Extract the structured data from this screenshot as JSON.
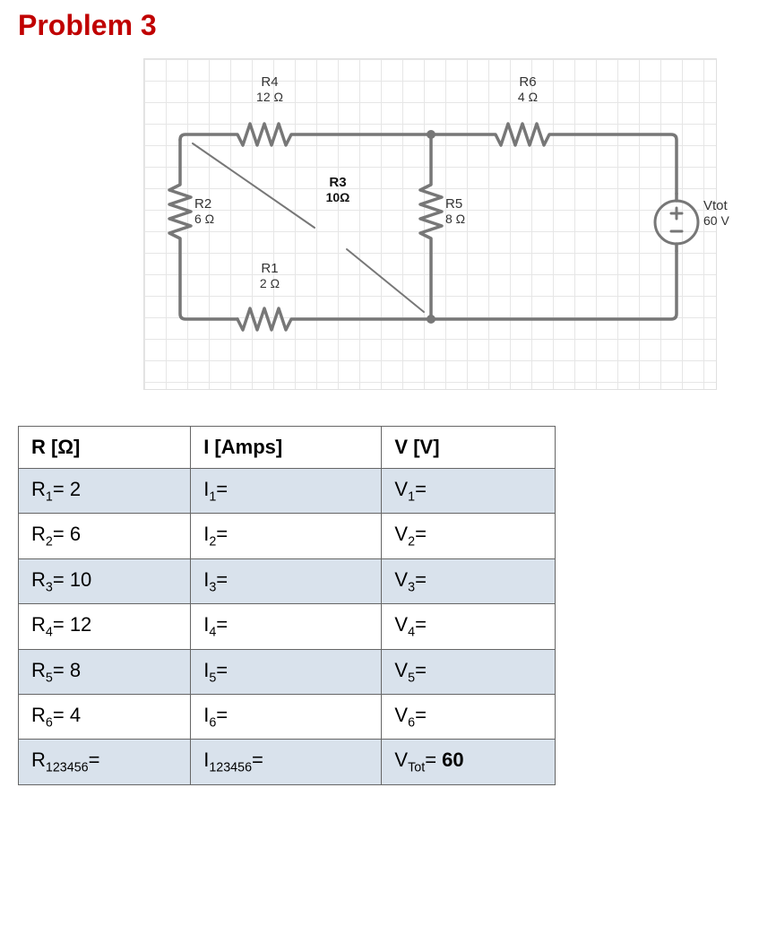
{
  "title": "Problem 3",
  "circuit": {
    "R1": {
      "name": "R1",
      "val": "2 Ω"
    },
    "R2": {
      "name": "R2",
      "val": "6 Ω"
    },
    "R3": {
      "name": "R3",
      "val": "10Ω"
    },
    "R4": {
      "name": "R4",
      "val": "12 Ω"
    },
    "R5": {
      "name": "R5",
      "val": "8 Ω"
    },
    "R6": {
      "name": "R6",
      "val": "4 Ω"
    },
    "V": {
      "name": "Vtot",
      "val": "60 V"
    }
  },
  "table": {
    "headers": {
      "r": "R [Ω]",
      "i": "I [Amps]",
      "v": "V [V]"
    },
    "rows": [
      {
        "r_sym": "R",
        "r_sub": "1",
        "r_val": "2",
        "i_sym": "I",
        "i_sub": "1",
        "i_val": "",
        "v_sym": "V",
        "v_sub": "1",
        "v_val": ""
      },
      {
        "r_sym": "R",
        "r_sub": "2",
        "r_val": "6",
        "i_sym": "I",
        "i_sub": "2",
        "i_val": "",
        "v_sym": "V",
        "v_sub": "2",
        "v_val": ""
      },
      {
        "r_sym": "R",
        "r_sub": "3",
        "r_val": "10",
        "i_sym": "I",
        "i_sub": "3",
        "i_val": "",
        "v_sym": "V",
        "v_sub": "3",
        "v_val": ""
      },
      {
        "r_sym": "R",
        "r_sub": "4",
        "r_val": "12",
        "i_sym": "I",
        "i_sub": "4",
        "i_val": "",
        "v_sym": "V",
        "v_sub": "4",
        "v_val": ""
      },
      {
        "r_sym": "R",
        "r_sub": "5",
        "r_val": "8",
        "i_sym": "I",
        "i_sub": "5",
        "i_val": "",
        "v_sym": "V",
        "v_sub": "5",
        "v_val": ""
      },
      {
        "r_sym": "R",
        "r_sub": "6",
        "r_val": "4",
        "i_sym": "I",
        "i_sub": "6",
        "i_val": "",
        "v_sym": "V",
        "v_sub": "6",
        "v_val": ""
      },
      {
        "r_sym": "R",
        "r_sub": "123456",
        "r_val": "",
        "i_sym": "I",
        "i_sub": "123456",
        "i_val": "",
        "v_sym": "V",
        "v_sub": "Tot",
        "v_val": "60",
        "v_bold": true
      }
    ]
  }
}
